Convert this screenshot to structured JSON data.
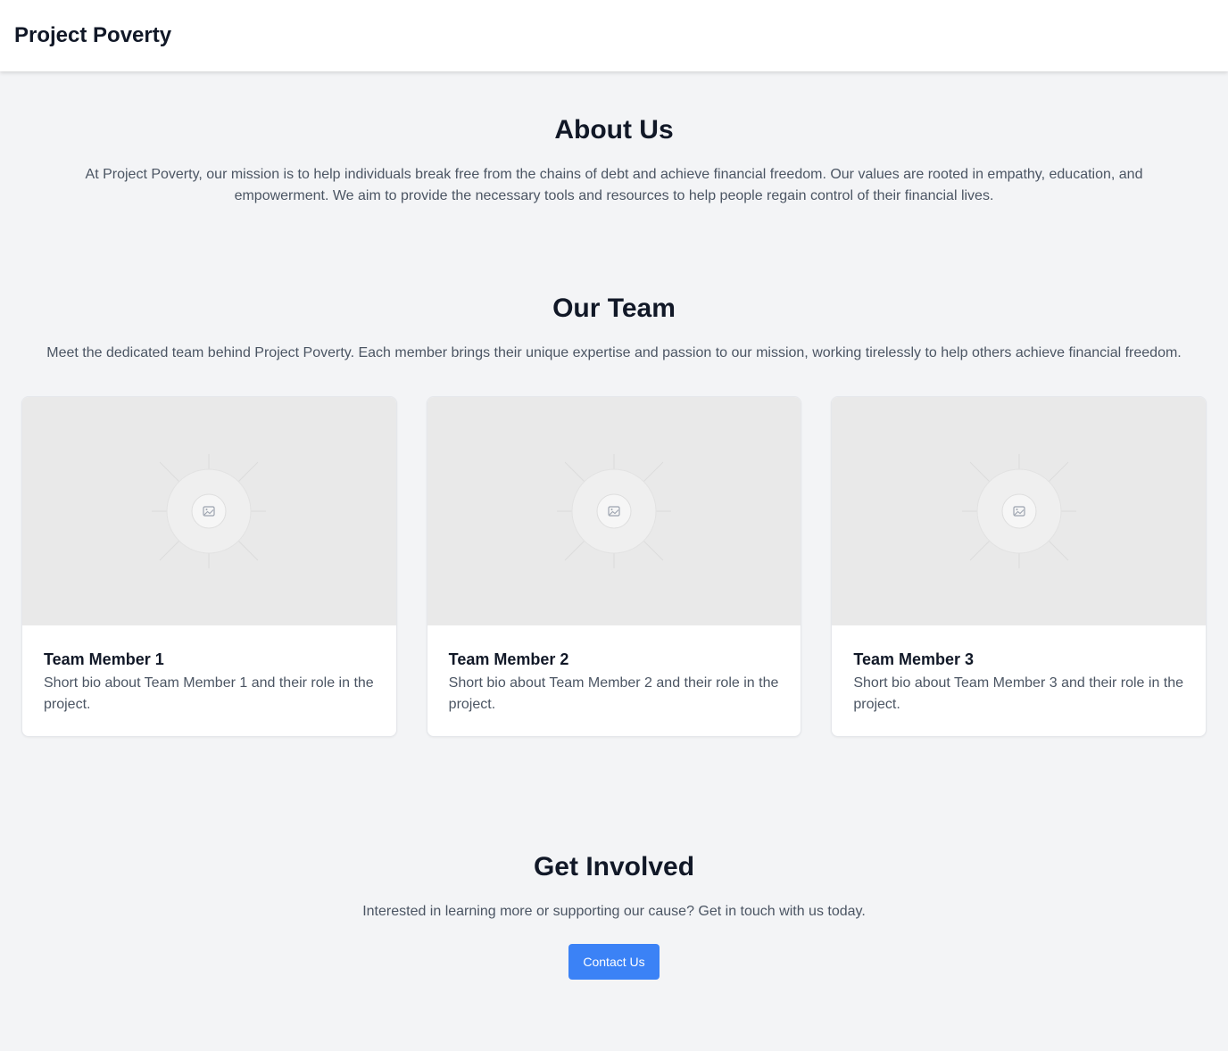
{
  "header": {
    "brand": "Project Poverty"
  },
  "about": {
    "title": "About Us",
    "text": "At Project Poverty, our mission is to help individuals break free from the chains of debt and achieve financial freedom. Our values are rooted in empathy, education, and empowerment. We aim to provide the necessary tools and resources to help people regain control of their financial lives."
  },
  "team": {
    "title": "Our Team",
    "text": "Meet the dedicated team behind Project Poverty. Each member brings their unique expertise and passion to our mission, working tirelessly to help others achieve financial freedom.",
    "members": [
      {
        "name": "Team Member 1",
        "bio": "Short bio about Team Member 1 and their role in the project.",
        "image_icon": "image-placeholder-icon"
      },
      {
        "name": "Team Member 2",
        "bio": "Short bio about Team Member 2 and their role in the project.",
        "image_icon": "image-placeholder-icon"
      },
      {
        "name": "Team Member 3",
        "bio": "Short bio about Team Member 3 and their role in the project.",
        "image_icon": "image-placeholder-icon"
      }
    ]
  },
  "involved": {
    "title": "Get Involved",
    "text": "Interested in learning more or supporting our cause? Get in touch with us today.",
    "button_label": "Contact Us"
  },
  "colors": {
    "background": "#f3f4f6",
    "accent": "#3b82f6",
    "heading": "#111827",
    "body_text": "#4b5563",
    "placeholder": "#e9e9e9"
  }
}
